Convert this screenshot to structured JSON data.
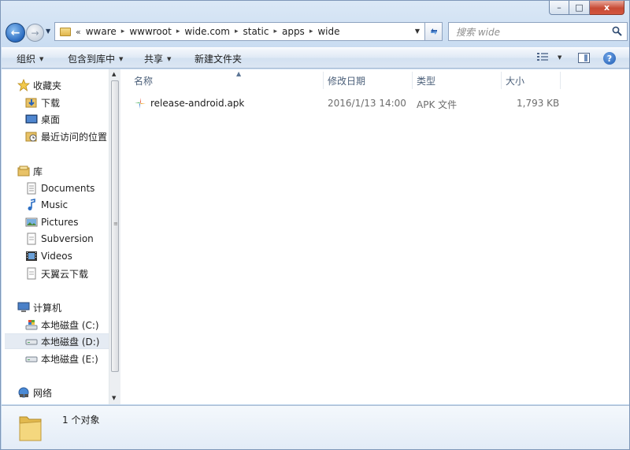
{
  "window": {
    "caption": {
      "minimize": "–",
      "maximize": "□",
      "close": "x"
    }
  },
  "navigation": {
    "back": "←",
    "forward": "→",
    "address": {
      "overflow": "«",
      "crumbs": [
        "wware",
        "wwwroot",
        "wide.com",
        "static",
        "apps",
        "wide"
      ]
    },
    "search": {
      "placeholder": "搜索 wide"
    }
  },
  "toolbar": {
    "organize": "组织",
    "include_in_library": "包含到库中",
    "share": "共享",
    "new_folder": "新建文件夹",
    "help": "?"
  },
  "sidebar": {
    "favorites": {
      "label": "收藏夹",
      "items": [
        "下载",
        "桌面",
        "最近访问的位置"
      ]
    },
    "libraries": {
      "label": "库",
      "items": [
        "Documents",
        "Music",
        "Pictures",
        "Subversion",
        "Videos",
        "天翼云下载"
      ]
    },
    "computer": {
      "label": "计算机",
      "items": [
        "本地磁盘 (C:)",
        "本地磁盘 (D:)",
        "本地磁盘 (E:)"
      ],
      "selected_index": 1
    },
    "network": {
      "label": "网络"
    }
  },
  "file_list": {
    "columns": {
      "name": "名称",
      "modified": "修改日期",
      "type": "类型",
      "size": "大小"
    },
    "rows": [
      {
        "name": "release-android.apk",
        "modified": "2016/1/13 14:00",
        "type": "APK 文件",
        "size": "1,793 KB"
      }
    ]
  },
  "details_pane": {
    "status": "1 个对象"
  },
  "colors": {
    "window_frame": "#c2d7ee",
    "selection": "#e5ebf3",
    "header_text": "#4c607a",
    "file_meta_text": "#6d6d6d"
  }
}
